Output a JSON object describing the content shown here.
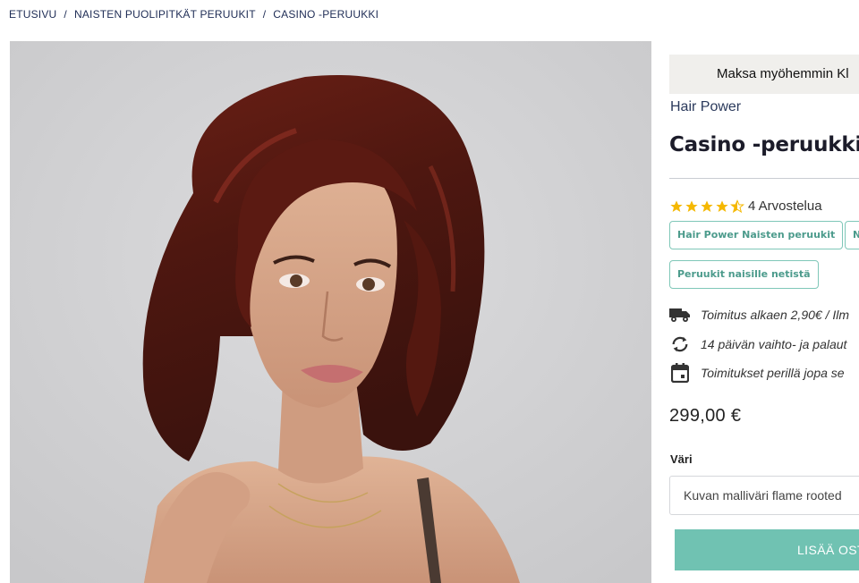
{
  "breadcrumb": {
    "items": [
      "ETUSIVU",
      "NAISTEN PUOLIPITKÄT PERUUKIT",
      "CASINO -PERUUKKI"
    ],
    "separator": "/"
  },
  "gallery": {
    "image_description_icon": "product-photo-woman-auburn-wig"
  },
  "product": {
    "paylater_text": "Maksa myöhemmin Kl",
    "brand": "Hair Power",
    "title": "Casino -peruukki",
    "rating": 4.5,
    "reviews_text": "4 Arvostelua",
    "tags": [
      "Hair Power Naisten peruukit",
      "N",
      "Peruukit naisille netistä"
    ],
    "shipping": [
      {
        "icon": "truck-icon",
        "text": "Toimitus alkaen 2,90€ / Ilm"
      },
      {
        "icon": "exchange-icon",
        "text": "14 päivän vaihto- ja palaut"
      },
      {
        "icon": "calendar-icon",
        "text": "Toimitukset perillä jopa se"
      }
    ],
    "price": "299,00 €",
    "variant_label": "Väri",
    "variant_value": "Kuvan malliväri flame rooted",
    "add_to_cart": "LISÄÄ OSTO"
  },
  "colors": {
    "accent": "#70c2b2",
    "tag_border": "#7fc7b8",
    "star": "#f5b800",
    "link": "#1e2c55"
  }
}
